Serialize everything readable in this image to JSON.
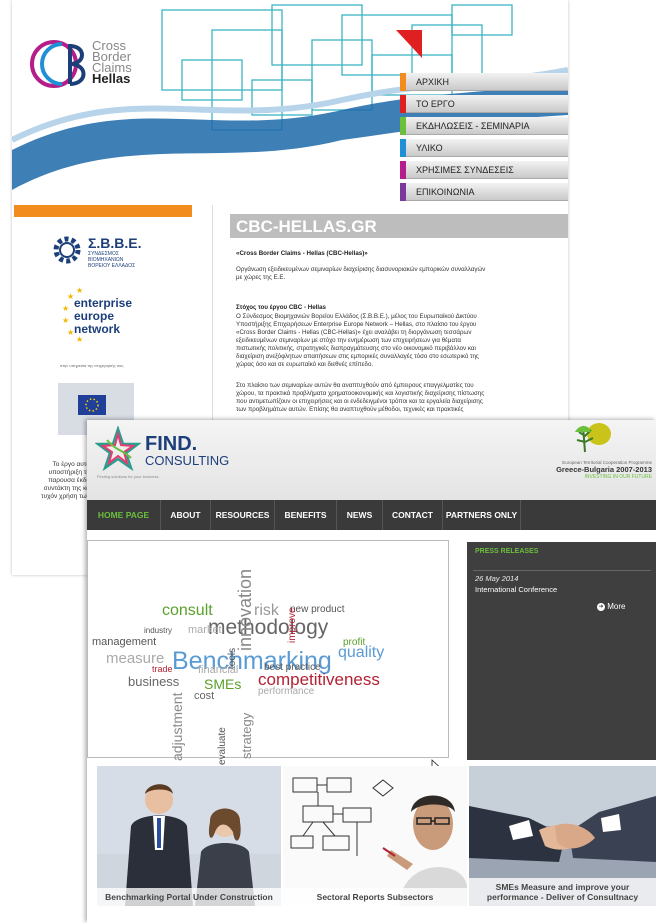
{
  "back_site": {
    "logo_text": [
      "Cross",
      "Border",
      "Claims",
      "Hellas"
    ],
    "menu": [
      {
        "label": "ΑΡΧΙΚΗ",
        "color": "#f28c1e"
      },
      {
        "label": "ΤΟ ΕΡΓΟ",
        "color": "#e02020"
      },
      {
        "label": "ΕΚΔΗΛΩΣΕΙΣ - ΣΕΜΙΝΑΡΙΑ",
        "color": "#6dbf3a"
      },
      {
        "label": "ΥΛΙΚΟ",
        "color": "#1f8fd6"
      },
      {
        "label": "ΧΡΗΣΙΜΕΣ ΣΥΝΔΕΣΕΙΣ",
        "color": "#b51e8a"
      },
      {
        "label": "ΕΠΙΚΟΙΝΩΝΙΑ",
        "color": "#7a3a9a"
      }
    ],
    "site_title": "CBC-HELLAS.GR",
    "sevbe": {
      "title": "Σ.Β.Β.Ε.",
      "sub1": "ΣΥΝΔΕΣΜΟΣ",
      "sub2": "ΒΙΟΜΗΧΑΝΙΩΝ",
      "sub3": "ΒΟΡΕΙΟΥ ΕΛΛΑΔΟΣ"
    },
    "een": [
      "enterprise",
      "europe",
      "network"
    ],
    "een_caption": "στην υπηρεσία της επιχείρησής σας",
    "left_text": [
      "Το έργο αυτό",
      "υποστήριξη τη",
      "παρουσα έκδο",
      "συντάκτη της κα",
      "τυχόν χρήση των"
    ],
    "heading": "«Cross Border Claims - Hellas (CBC-Hellas)»",
    "intro": [
      "Οργάνωση εξειδικευμένων σεμιναρίων διαχείρισης διασυνοριακών εμπορικών συναλλαγών",
      "με χώρες της Ε.Ε."
    ],
    "goal_heading": "Στόχος του έργου CBC - Hellas",
    "goal_lines": [
      "Ο Σύνδεσμος Βιομηχανιών Βορείου Ελλάδος (Σ.Β.Β.Ε.), μέλος του Ευρωπαϊκού Δικτύου",
      "Υποστήριξης Επιχειρήσεων Enterprise Europe Network – Hellas, στο πλαίσιο του έργου",
      "«Cross Border Claims - Hellas (CBC-Hellas)» έχει αναλάβει τη διοργάνωση τεσσάρων",
      "εξειδικευμένων σεμιναρίων με στόχο την ενημέρωση των επιχειρήσεων για θέματα",
      "πιστωτικής πολιτικής, στρατηγικές διαπραγμάτευσης στο νέο οικονομικό περιβάλλον και",
      "διαχείριση ανεξόφλητων απαιτήσεων στις εμπορικές συναλλαγές τόσο στο εσωτερικό της",
      "χώρας όσο και σε ευρωπαϊκό και διεθνές επίπεδο."
    ],
    "para2_lines": [
      "Στο πλαίσιο των σεμιναρίων αυτών θα αναπτυχθούν από έμπειρους επαγγελματίες του",
      "χώρου, τα πρακτικά προβλήματα χρηματοοικονομικής και λογιστικής διαχείρισης πίστωσης",
      "που αντιμετωπίζουν οι επιχειρήσεις και οι ενδεδειγμένοι τρόποι και τα εργαλεία διαχείρισης",
      "των προβλημάτων αυτών. Επίσης θα αναπτυχθούν μέθοδοι, τεχνικές και πρακτικές"
    ]
  },
  "front_site": {
    "logo_name": "FIND.",
    "logo_sub": "CONSULTING",
    "logo_tagline": "Finding solutions for your business",
    "programme_line1": "European Territorial Cooperation Programme",
    "programme_line2": "Greece-Bulgaria 2007-2013",
    "programme_line3": "INVESTING IN OUR FUTURE",
    "nav": [
      "HOME PAGE",
      "ABOUT",
      "RESOURCES",
      "BENEFITS",
      "NEWS",
      "CONTACT",
      "PARTNERS ONLY"
    ],
    "press": {
      "title": "PRESS RELEASES",
      "date": "26 May 2014",
      "item": "International Conference",
      "more": "More"
    },
    "cloud": [
      {
        "t": "Benchmarking",
        "c": "#5b9bd5"
      },
      {
        "t": "methodology",
        "c": "#666666"
      },
      {
        "t": "competitiveness",
        "c": "#b22234"
      },
      {
        "t": "quality",
        "c": "#5b9bd5"
      },
      {
        "t": "consult",
        "c": "#5aa02c"
      },
      {
        "t": "innovation",
        "c": "#888888"
      },
      {
        "t": "risk",
        "c": "#999999"
      },
      {
        "t": "new product",
        "c": "#555555"
      },
      {
        "t": "improve",
        "c": "#b22234"
      },
      {
        "t": "tools",
        "c": "#555555"
      },
      {
        "t": "industry",
        "c": "#555555"
      },
      {
        "t": "market",
        "c": "#aaaaaa"
      },
      {
        "t": "management",
        "c": "#555555"
      },
      {
        "t": "measure",
        "c": "#aaaaaa"
      },
      {
        "t": "trade",
        "c": "#b22234"
      },
      {
        "t": "business",
        "c": "#666666"
      },
      {
        "t": "financial",
        "c": "#aaaaaa"
      },
      {
        "t": "SMEs",
        "c": "#5aa02c"
      },
      {
        "t": "cost",
        "c": "#666666"
      },
      {
        "t": "best practice",
        "c": "#555555"
      },
      {
        "t": "performance",
        "c": "#aaaaaa"
      },
      {
        "t": "profit",
        "c": "#5aa02c"
      },
      {
        "t": "adjustment",
        "c": "#888888"
      },
      {
        "t": "evaluate",
        "c": "#555555"
      },
      {
        "t": "strategy",
        "c": "#888888"
      }
    ],
    "tiles": [
      "Benchmarking Portal Under Construction",
      "Sectoral Reports Subsectors",
      "SMEs Measure and improve your performance - Deliver of Consultnacy"
    ]
  }
}
